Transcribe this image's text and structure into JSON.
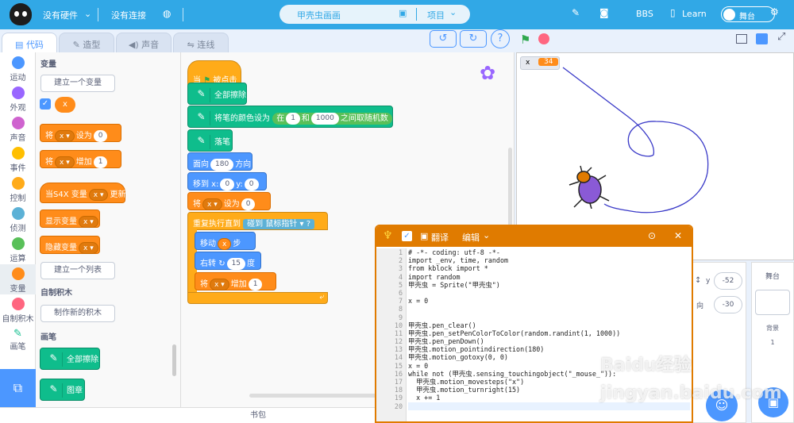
{
  "topbar": {
    "hardware": "没有硬件",
    "connection": "没有连接",
    "project_name": "甲壳虫画画",
    "project_menu": "项目",
    "bbs": "BBS",
    "learn": "Learn",
    "stage_toggle": "舞台"
  },
  "tabs": {
    "code": "代码",
    "costume": "造型",
    "sound": "声音",
    "connect": "连线"
  },
  "categories": [
    "运动",
    "外观",
    "声音",
    "事件",
    "控制",
    "侦测",
    "运算",
    "变量",
    "自制积木",
    "画笔"
  ],
  "category_colors": [
    "#4c97ff",
    "#9966ff",
    "#cf63cf",
    "#ffbf00",
    "#ffab19",
    "#5cb1d6",
    "#59c059",
    "#ff8c1a",
    "#ff6680",
    "#0fbd8c"
  ],
  "palette": {
    "var_header": "变量",
    "make_var": "建立一个变量",
    "var_name": "x",
    "set_text": "将",
    "set_to": "设为",
    "set_val": "0",
    "change_text": "将",
    "change_by": "增加",
    "change_val": "1",
    "s4x_label": "当S4X 变量",
    "s4x_update": "更新",
    "show_var": "显示变量",
    "hide_var": "隐藏变量",
    "make_list": "建立一个列表",
    "custom_header": "自制积木",
    "make_block": "制作新的积木",
    "pen_header": "画笔",
    "clear_all": "全部擦除",
    "stamp": "图章"
  },
  "script": {
    "when_flag": "当",
    "clicked": "被点击",
    "clear": "全部擦除",
    "set_pen_color": "将笔的颜色设为",
    "in": "在",
    "rand_from": "1",
    "and": "和",
    "rand_to": "1000",
    "between": "之间取随机数",
    "pen_down": "落笔",
    "point": "面向",
    "point_val": "180",
    "direction": "方向",
    "goto": "移到 x:",
    "goto_x": "0",
    "goto_y_label": "y:",
    "goto_y": "0",
    "set": "将",
    "var": "x",
    "set_to": "设为",
    "set_val": "0",
    "repeat_until": "重复执行直到",
    "touching": "碰到",
    "mouse_pointer": "鼠标指针",
    "q": "?",
    "move": "移动",
    "move_val": "x",
    "steps": "步",
    "turn": "右转",
    "turn_val": "15",
    "degrees": "度",
    "change": "将",
    "change_by": "增加",
    "change_val": "1"
  },
  "stage": {
    "monitor_label": "x",
    "monitor_value": "34"
  },
  "sprite_pane": {
    "y_label": "y",
    "y_val": "-52",
    "dir_label": "向",
    "dir_val": "-30"
  },
  "backdrop": {
    "title": "舞台",
    "label": "背景",
    "count": "1"
  },
  "editor": {
    "translate": "翻译",
    "edit": "编辑",
    "lines": [
      "# -*- coding: utf-8 -*-",
      "import _env, time, random",
      "from kblock import *",
      "import random",
      "甲壳虫 = Sprite(\"甲壳虫\")",
      "",
      "x = 0",
      "",
      "",
      "甲壳虫.pen_clear()",
      "甲壳虫.pen_setPenColorToColor(random.randint(1, 1000))",
      "甲壳虫.pen_penDown()",
      "甲壳虫.motion_pointindirection(180)",
      "甲壳虫.motion_gotoxy(0, 0)",
      "x = 0",
      "while not (甲壳虫.sensing_touchingobject(\"_mouse_\")):",
      "  甲壳虫.motion_movesteps(\"x\")",
      "  甲壳虫.motion_turnright(15)",
      "  x += 1",
      ""
    ],
    "line_numbers": [
      "1",
      "2",
      "3",
      "4",
      "5",
      "6",
      "7",
      "8",
      "9",
      "10",
      "11",
      "12",
      "13",
      "14",
      "15",
      "16",
      "17",
      "18",
      "19",
      "20"
    ]
  },
  "bottom": {
    "backpack": "书包"
  },
  "watermark": "Baidu经验 jingyan.baidu.com"
}
